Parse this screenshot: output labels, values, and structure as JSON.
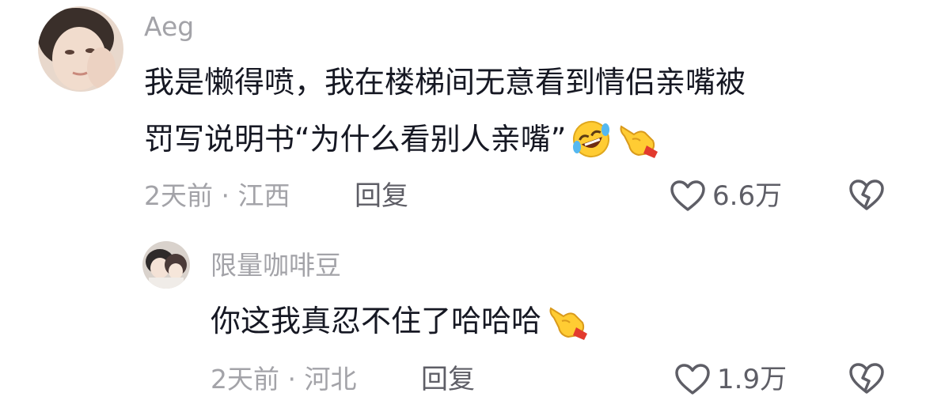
{
  "comment": {
    "username": "Aeg",
    "text_lines": [
      "我是懒得喷，我在楼梯间无意看到情侣亲嘴被",
      "罚写说明书“为什么看别人亲嘴”"
    ],
    "emojis": [
      "rolling-on-floor-laughing-emoji",
      "pointing-hand-emoji"
    ],
    "time": "2天前",
    "separator": " · ",
    "location": "江西",
    "reply_label": "回复",
    "like_count": "6.6万"
  },
  "reply": {
    "username": "限量咖啡豆",
    "text": "你这我真忍不住了哈哈哈",
    "emojis": [
      "pointing-hand-emoji"
    ],
    "time": "2天前",
    "separator": " · ",
    "location": "河北",
    "reply_label": "回复",
    "like_count": "1.9万"
  },
  "icons": {
    "like": "heart-outline-icon",
    "dislike": "broken-heart-outline-icon"
  },
  "colors": {
    "primary_text": "#161823",
    "secondary_text": "#a3a3a8",
    "action_text": "#5e5e66",
    "background": "#ffffff"
  }
}
